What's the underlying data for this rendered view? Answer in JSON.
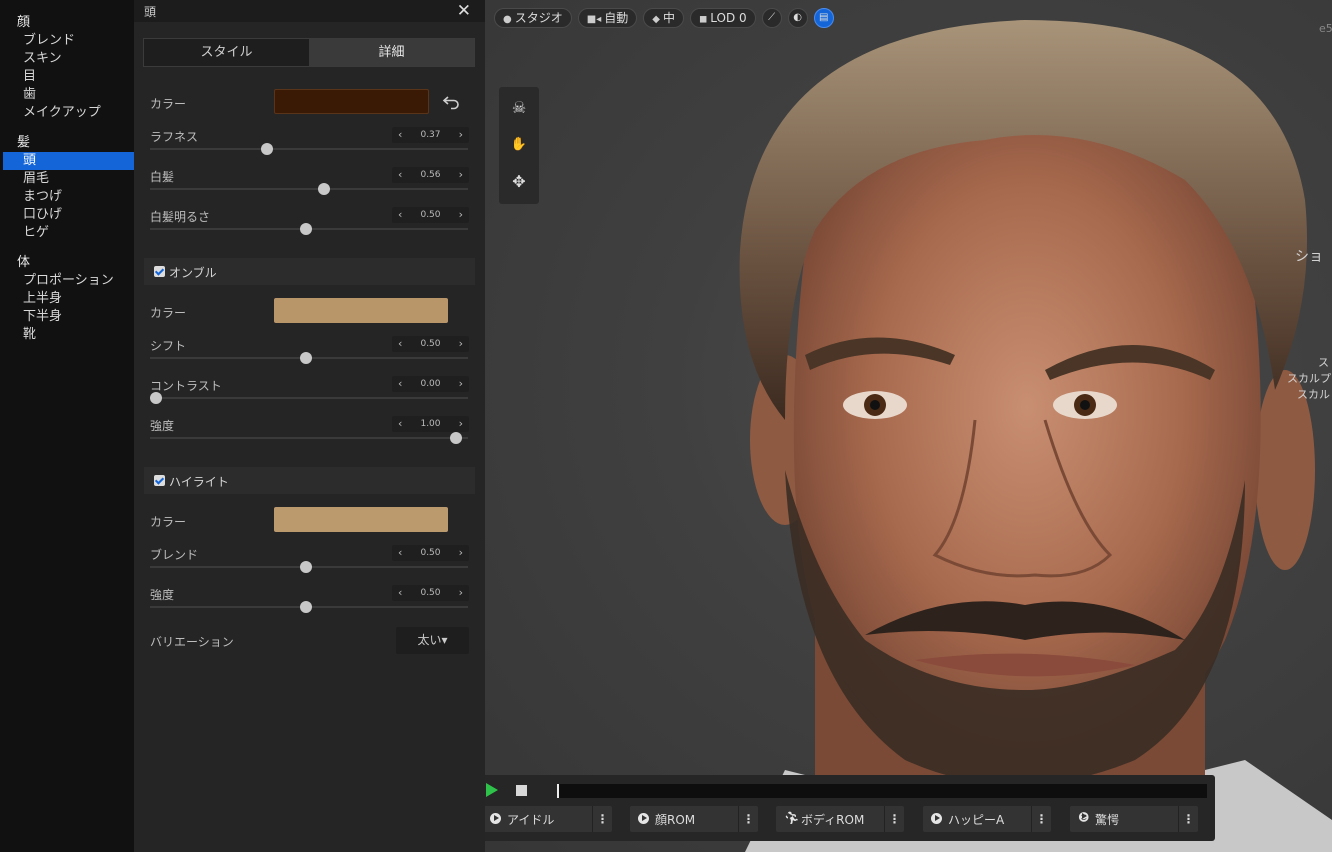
{
  "nav": {
    "categories": [
      {
        "label": "顔",
        "items": [
          "ブレンド",
          "スキン",
          "目",
          "歯",
          "メイクアップ"
        ]
      },
      {
        "label": "髪",
        "items": [
          "頭",
          "眉毛",
          "まつげ",
          "口ひげ",
          "ヒゲ"
        ]
      },
      {
        "label": "体",
        "items": [
          "プロポーション",
          "上半身",
          "下半身",
          "靴"
        ]
      }
    ],
    "active_item": "頭"
  },
  "panel": {
    "title": "頭",
    "close_glyph": "✕",
    "tabs": [
      "スタイル",
      "詳細"
    ],
    "selected_tab": "詳細",
    "color_label": "カラー",
    "base_color": "#3a1a05",
    "roughness": {
      "label": "ラフネス",
      "value": "0.37",
      "fraction": 0.37
    },
    "gray": {
      "label": "白髪",
      "value": "0.56",
      "fraction": 0.56
    },
    "gray_brightness": {
      "label": "白髪明るさ",
      "value": "0.50",
      "fraction": 0.5
    },
    "ombre": {
      "label": "オンブル",
      "color_label": "カラー",
      "color": "#b8966a",
      "shift": {
        "label": "シフト",
        "value": "0.50",
        "fraction": 0.5
      },
      "contrast": {
        "label": "コントラスト",
        "value": "0.00",
        "fraction": 0.0
      },
      "intensity": {
        "label": "強度",
        "value": "1.00",
        "fraction": 1.0
      }
    },
    "highlight": {
      "label": "ハイライト",
      "color_label": "カラー",
      "color": "#bb9a6e",
      "blend": {
        "label": "ブレンド",
        "value": "0.50",
        "fraction": 0.5
      },
      "intensity": {
        "label": "強度",
        "value": "0.50",
        "fraction": 0.5
      }
    },
    "variation": {
      "label": "バリエーション",
      "value": "太い▾"
    }
  },
  "viewport": {
    "toolbar": [
      {
        "icon": "light-icon",
        "glyph": "●",
        "label": "スタジオ"
      },
      {
        "icon": "camera-icon",
        "glyph": "■◂",
        "label": "自動"
      },
      {
        "icon": "quality-icon",
        "glyph": "◆",
        "label": "中"
      },
      {
        "icon": "lod-icon",
        "glyph": "◼",
        "label": "LOD 0"
      }
    ],
    "toolbar_circles": [
      {
        "icon": "hair-toggle-icon",
        "glyph": "⟋"
      },
      {
        "icon": "clothing-toggle-icon",
        "glyph": "◐"
      },
      {
        "icon": "grid-toggle-icon",
        "glyph": "▤",
        "on": true
      }
    ],
    "side_texts": [
      "ショ",
      "ス",
      "スカルプ",
      "スカル",
      "e5"
    ]
  },
  "player": {
    "animations": [
      {
        "label": "アイドル",
        "icon": "play-circle-icon"
      },
      {
        "label": "顔ROM",
        "icon": "play-circle-icon"
      },
      {
        "label": "ボディROM",
        "icon": "running-icon"
      },
      {
        "label": "ハッピーA",
        "icon": "play-circle-icon"
      },
      {
        "label": "驚愕",
        "icon": "head-icon"
      }
    ],
    "menu_glyph": "⋮"
  }
}
